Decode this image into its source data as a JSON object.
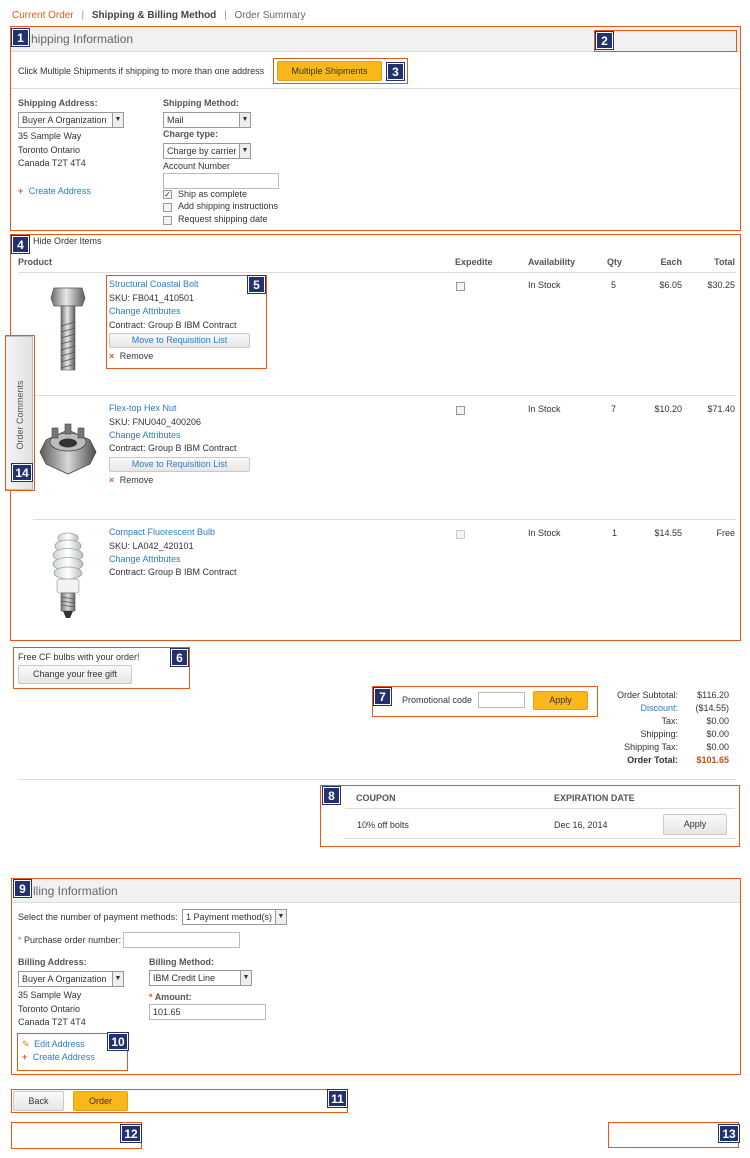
{
  "breadcrumb": {
    "step1": "Current Order",
    "step2": "Shipping & Billing Method",
    "step3": "Order Summary",
    "sep": "|"
  },
  "shipping": {
    "section_title": "hipping Information",
    "multi_hint": "Click Multiple Shipments if shipping to more than one address",
    "multi_button": "Multiple Shipments",
    "address_label": "Shipping Address:",
    "address_select": "Buyer A Organization",
    "address_lines": [
      "35 Sample Way",
      "Toronto Ontario",
      "Canada T2T 4T4"
    ],
    "create_address": "Create Address",
    "method_label": "Shipping Method:",
    "method_select": "Mail",
    "charge_label": "Charge type:",
    "charge_select": "Charge by carrier",
    "account_label": "Account Number",
    "account_value": "",
    "options": [
      {
        "label": "Ship as complete",
        "checked": true
      },
      {
        "label": "Add shipping instructions",
        "checked": false
      },
      {
        "label": "Request shipping date",
        "checked": false
      }
    ]
  },
  "items": {
    "toggle_label": "Hide Order Items",
    "columns": {
      "product": "Product",
      "expedite": "Expedite",
      "availability": "Availability",
      "qty": "Qty",
      "each": "Each",
      "total": "Total"
    },
    "rows": [
      {
        "name": "Structural Coastal Bolt",
        "sku": "SKU: FB041_410501",
        "change": "Change Attributes",
        "contract": "Contract: Group B IBM Contract",
        "move": "Move to Requisition List",
        "remove": "Remove",
        "availability": "In Stock",
        "qty": "5",
        "each": "$6.05",
        "total": "$30.25",
        "image": "bolt-image"
      },
      {
        "name": "Flex-top Hex Nut",
        "sku": "SKU: FNU040_400206",
        "change": "Change Attributes",
        "contract": "Contract: Group B IBM Contract",
        "move": "Move to Requisition List",
        "remove": "Remove",
        "availability": "In Stock",
        "qty": "7",
        "each": "$10.20",
        "total": "$71.40",
        "image": "nut-image"
      },
      {
        "name": "Compact Fluorescent Bulb",
        "sku": "SKU: LA042_420101",
        "change": "Change Attributes",
        "contract": "Contract: Group B IBM Contract",
        "availability": "In Stock",
        "qty": "1",
        "each": "$14.55",
        "total": "Free",
        "image": "bulb-image"
      }
    ]
  },
  "order_comments_tab": "Order Comments",
  "gift": {
    "text": "Free CF bulbs with your order!",
    "button": "Change your free gift"
  },
  "promo": {
    "label": "Promotional code",
    "value": "",
    "button": "Apply"
  },
  "totals": {
    "subtotal_label": "Order Subtotal:",
    "subtotal": "$116.20",
    "discount_label": "Discount:",
    "discount": "($14.55)",
    "tax_label": "Tax:",
    "tax": "$0.00",
    "shipping_label": "Shipping:",
    "shipping": "$0.00",
    "shipping_tax_label": "Shipping Tax:",
    "shipping_tax": "$0.00",
    "total_label": "Order Total:",
    "total": "$101.65"
  },
  "coupons": {
    "col_coupon": "COUPON",
    "col_expiration": "EXPIRATION DATE",
    "rows": [
      {
        "coupon": "10% off bolts",
        "expiration": "Dec 16, 2014",
        "button": "Apply"
      }
    ]
  },
  "billing": {
    "section_title": "lling Information",
    "payment_label": "Select the number of payment methods:",
    "payment_select": "1 Payment method(s)",
    "po_label": "Purchase order number:",
    "po_value": "",
    "address_label": "Billing Address:",
    "address_select": "Buyer A Organization",
    "address_lines": [
      "35 Sample Way",
      "Toronto Ontario",
      "Canada T2T 4T4"
    ],
    "edit_address": "Edit Address",
    "create_address": "Create Address",
    "method_label": "Billing Method:",
    "method_select": "IBM Credit Line",
    "amount_label": "Amount:",
    "amount_value": "101.65"
  },
  "footer": {
    "back": "Back",
    "order": "Order"
  },
  "callouts": [
    "1",
    "2",
    "3",
    "4",
    "5",
    "6",
    "7",
    "8",
    "9",
    "10",
    "11",
    "12",
    "13",
    "14"
  ],
  "colors": {
    "accent": "#e2591b",
    "button": "#f9b71a",
    "badge": "#23326e",
    "link": "#2e7bc4",
    "total": "#c0501b"
  }
}
